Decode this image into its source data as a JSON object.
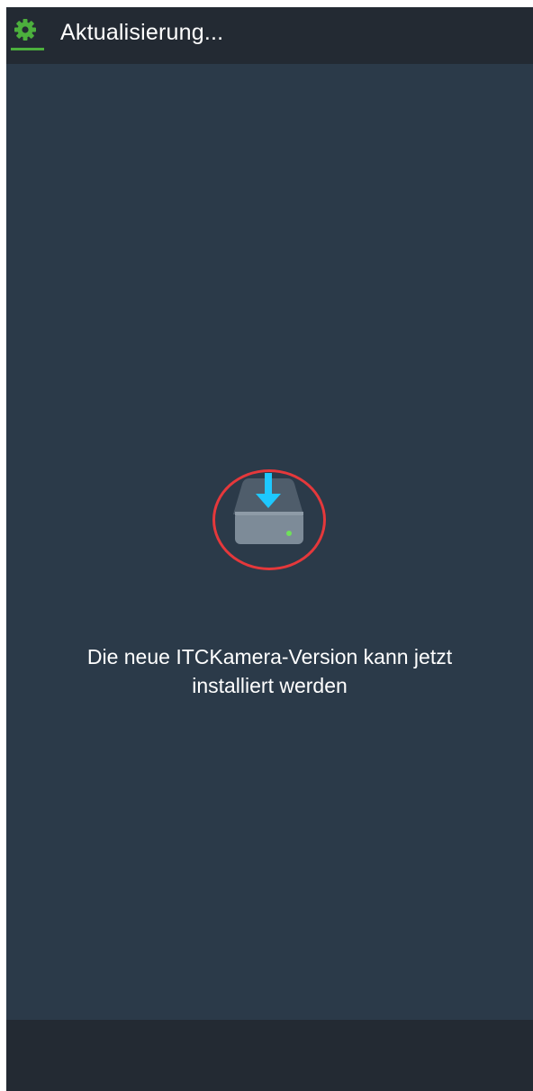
{
  "header": {
    "title": "Aktualisierung...",
    "icon": "gear-icon",
    "icon_color": "#4caf3d"
  },
  "main": {
    "icon": "download-drive-icon",
    "message_line1": "Die neue ITCKamera-Version kann jetzt",
    "message_line2": "installiert werden"
  },
  "colors": {
    "background": "#2b3a49",
    "bars": "#232a33",
    "accent_arrow": "#1ec8ff",
    "highlight_ring": "#e5383b"
  }
}
